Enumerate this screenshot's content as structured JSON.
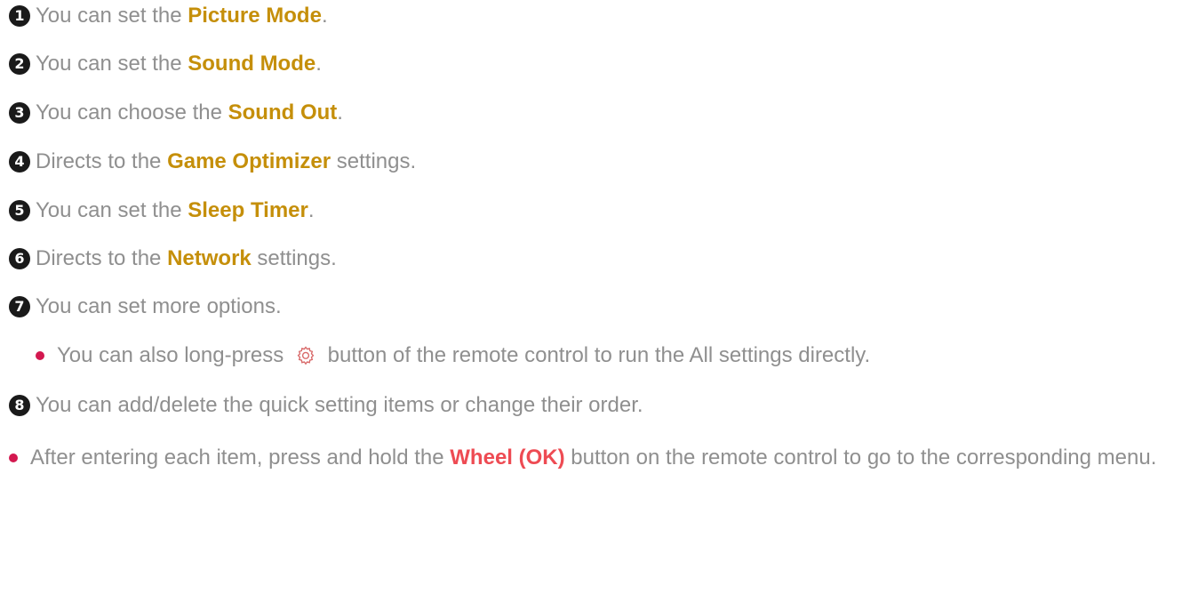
{
  "items": [
    {
      "num": "1",
      "pre": "You can set the ",
      "hl": "Picture Mode",
      "post": "."
    },
    {
      "num": "2",
      "pre": "You can set the ",
      "hl": "Sound Mode",
      "post": "."
    },
    {
      "num": "3",
      "pre": "You can choose the ",
      "hl": "Sound Out",
      "post": "."
    },
    {
      "num": "4",
      "pre": "Directs to the ",
      "hl": "Game Optimizer",
      "post": " settings."
    },
    {
      "num": "5",
      "pre": "You can set the ",
      "hl": "Sleep Timer",
      "post": "."
    },
    {
      "num": "6",
      "pre": "Directs to the ",
      "hl": "Network",
      "post": " settings."
    },
    {
      "num": "7",
      "text": "You can set more options."
    },
    {
      "num": "8",
      "text": "You can add/delete the quick setting items or change their order."
    }
  ],
  "sub_note": {
    "pre": "You can also long-press ",
    "icon": "gear-icon",
    "post": " button of the remote control to run the All settings directly."
  },
  "note": {
    "pre": "After entering each item, press and hold the ",
    "hl": "Wheel (OK)",
    "post": " button on the remote control to go to the corresponding menu."
  },
  "colors": {
    "text": "#8f8f8f",
    "highlight": "#c58f0a",
    "highlight_red": "#ee4b53",
    "bullet": "#d3184f",
    "number_badge": "#1a1a1a"
  }
}
